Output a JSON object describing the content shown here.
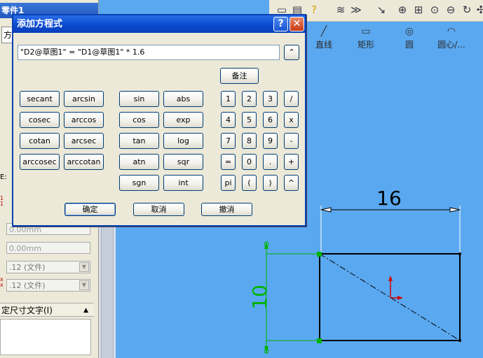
{
  "background": {
    "left_panel": {
      "title": "零件1",
      "tab_label": "方",
      "field_1": "0.00mm",
      "field_2": "0.00mm",
      "select_1": ".12 (文件)",
      "select_2": ".12 (文件)",
      "section_header": "定尺寸文字(I)",
      "side_label": "E:"
    },
    "command_bar": {
      "items": [
        {
          "label": "直线",
          "icon": "line-icon"
        },
        {
          "label": "矩形",
          "icon": "rectangle-icon"
        },
        {
          "label": "圆",
          "icon": "circle-icon"
        },
        {
          "label": "圆心/...",
          "icon": "center-arc-icon"
        }
      ]
    },
    "sketch": {
      "horizontal_dim": "16",
      "vertical_dim": "10",
      "colors": {
        "dimension_h": "#000000",
        "dimension_v": "#00b400",
        "origin": "#d00000"
      }
    }
  },
  "dialog": {
    "title": "添加方程式",
    "equation_value": "\"D2@草图1\" = \"D1@草图1\" * 1.6",
    "note_button": "备注",
    "functions_col1": [
      "secant",
      "cosec",
      "cotan",
      "arccosec"
    ],
    "functions_col2": [
      "arcsin",
      "arccos",
      "arcsec",
      "arccotan"
    ],
    "functions_col3": [
      "sin",
      "cos",
      "tan",
      "atn",
      "sgn"
    ],
    "functions_col4": [
      "abs",
      "exp",
      "log",
      "sqr",
      "int"
    ],
    "keypad_rows": [
      [
        "1",
        "2",
        "3",
        "/"
      ],
      [
        "4",
        "5",
        "6",
        "x"
      ],
      [
        "7",
        "8",
        "9",
        "-"
      ],
      [
        "=",
        "0",
        ".",
        "+"
      ],
      [
        "pi",
        "(",
        ")",
        "^"
      ]
    ],
    "footer": {
      "ok": "确定",
      "cancel": "取消",
      "undo": "撤消"
    }
  },
  "colors": {
    "dialog_border": "#0842b0",
    "viewport_bg": "#5aa8f0",
    "panel_bg": "#ece9d8"
  }
}
